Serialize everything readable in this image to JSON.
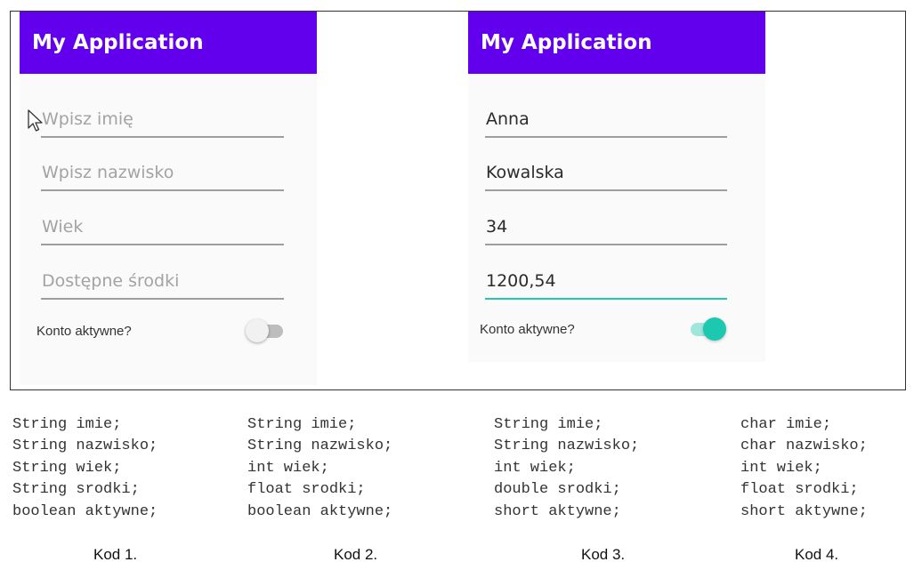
{
  "screens": [
    {
      "app_title": "My Application",
      "fields": [
        {
          "placeholder": "Wpisz imię",
          "value": ""
        },
        {
          "placeholder": "Wpisz nazwisko",
          "value": ""
        },
        {
          "placeholder": "Wiek",
          "value": ""
        },
        {
          "placeholder": "Dostępne środki",
          "value": ""
        }
      ],
      "toggle_label": "Konto aktywne?",
      "toggle_on": false
    },
    {
      "app_title": "My Application",
      "fields": [
        {
          "placeholder": "",
          "value": "Anna"
        },
        {
          "placeholder": "",
          "value": "Kowalska"
        },
        {
          "placeholder": "",
          "value": "34"
        },
        {
          "placeholder": "",
          "value": "1200,54"
        }
      ],
      "toggle_label": "Konto aktywne?",
      "toggle_on": true
    }
  ],
  "code_blocks": [
    {
      "lines": [
        "String imie;",
        "String nazwisko;",
        "String wiek;",
        "String srodki;",
        "boolean aktywne;"
      ],
      "caption": "Kod 1."
    },
    {
      "lines": [
        "String imie;",
        "String nazwisko;",
        "int wiek;",
        "float srodki;",
        "boolean aktywne;"
      ],
      "caption": "Kod 2."
    },
    {
      "lines": [
        "String imie;",
        "String nazwisko;",
        "int wiek;",
        "double srodki;",
        "short aktywne;"
      ],
      "caption": "Kod 3."
    },
    {
      "lines": [
        "char imie;",
        "char nazwisko;",
        "int wiek;",
        "float srodki;",
        "short aktywne;"
      ],
      "caption": "Kod 4."
    }
  ],
  "colors": {
    "app_bar": "#6200ee",
    "accent": "#1cc8b0",
    "hint_text": "#a3a3a3"
  }
}
